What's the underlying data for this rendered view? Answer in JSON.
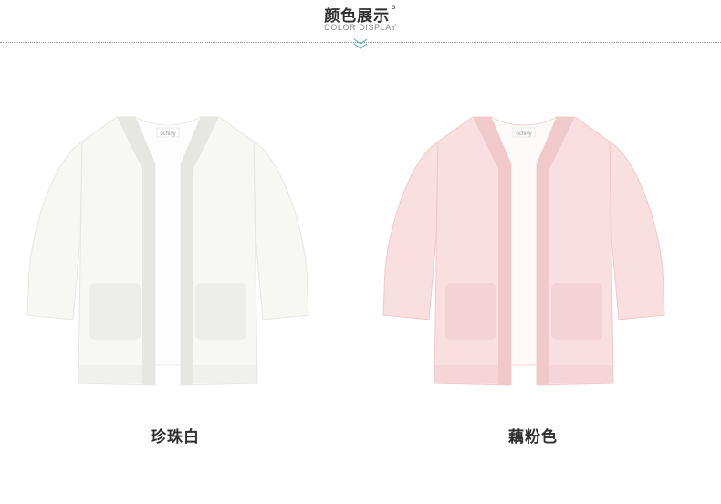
{
  "header": {
    "title": "颜色展示",
    "title_mark": "°",
    "subtitle": "COLOR DISPLAY"
  },
  "products": [
    {
      "name": "珍珠白",
      "color": "#f7f7f4",
      "shadow": "#e6e6e2",
      "inner": "#fdfdfd"
    },
    {
      "name": "藕粉色",
      "color": "#f9dfe0",
      "shadow": "#f0c9cb",
      "inner": "#fefafa"
    }
  ],
  "label": {
    "brand_tag": "ochirly"
  },
  "icons": {
    "divider": "double-chevron-down-icon"
  }
}
